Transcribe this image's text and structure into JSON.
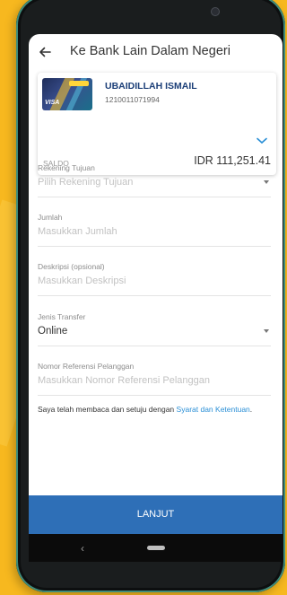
{
  "header": {
    "title": "Ke Bank Lain Dalam Negeri"
  },
  "account": {
    "name": "UBAIDILLAH ISMAIL",
    "number": "1210011071994",
    "balance_label": "SALDO",
    "balance": "IDR 111,251.41"
  },
  "fields": {
    "destination": {
      "label": "Rekening Tujuan",
      "placeholder": "Pilih Rekening Tujuan"
    },
    "amount": {
      "label": "Jumlah",
      "placeholder": "Masukkan Jumlah"
    },
    "description": {
      "label": "Deskripsi (opsional)",
      "placeholder": "Masukkan Deskripsi"
    },
    "transfer_type": {
      "label": "Jenis Transfer",
      "value": "Online"
    },
    "reference": {
      "label": "Nomor Referensi Pelanggan",
      "placeholder": "Masukkan Nomor Referensi Pelanggan"
    }
  },
  "agreement": {
    "text": "Saya telah membaca dan setuju dengan",
    "link": "Syarat dan Ketentuan",
    "end": "."
  },
  "actions": {
    "submit_label": "LANJUT"
  },
  "system_nav": {
    "back": "‹"
  },
  "colors": {
    "accent": "#2e6fb7",
    "link": "#2a8fd6",
    "background": "#f7b81f"
  }
}
